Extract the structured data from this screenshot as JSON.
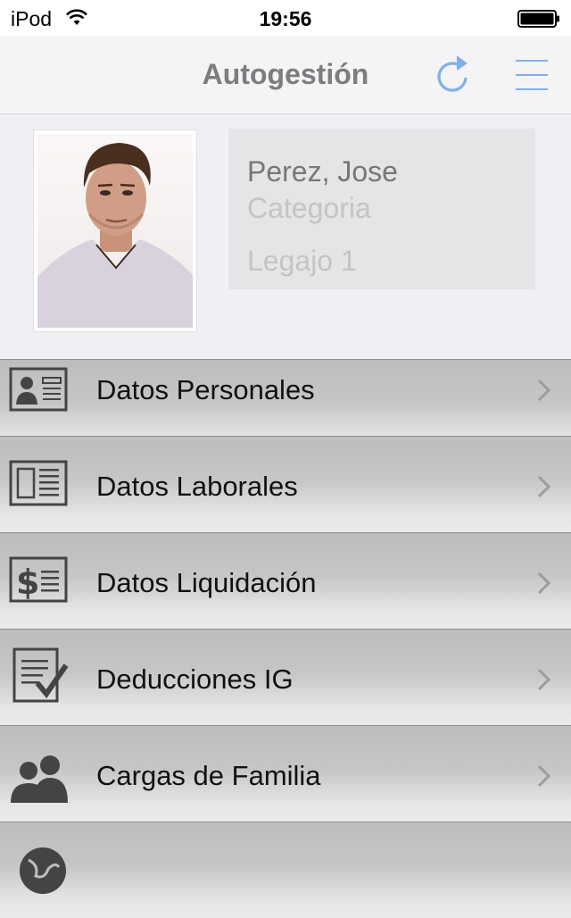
{
  "status_bar": {
    "carrier": "iPod",
    "time": "19:56",
    "icons": [
      "wifi-icon",
      "battery-icon"
    ]
  },
  "nav": {
    "title": "Autogestión",
    "icons": [
      "refresh-icon",
      "hamburger-menu-icon"
    ],
    "accent_color": "#7fb0ea"
  },
  "profile": {
    "name": "Perez, Jose",
    "category": "Categoria",
    "legajo": "Legajo 1"
  },
  "menu": {
    "items": [
      {
        "label": "Datos Personales",
        "icon": "id-card-icon"
      },
      {
        "label": "Datos Laborales",
        "icon": "document-card-icon"
      },
      {
        "label": "Datos Liquidación",
        "icon": "dollar-card-icon"
      },
      {
        "label": "Deducciones IG",
        "icon": "checklist-icon"
      },
      {
        "label": "Cargas de Familia",
        "icon": "people-icon"
      },
      {
        "label": "",
        "icon": "globe-icon"
      }
    ]
  }
}
